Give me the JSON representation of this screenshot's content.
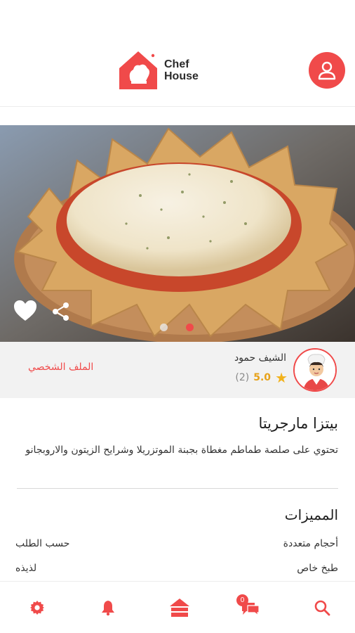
{
  "header": {
    "logo_line1": "Chef",
    "logo_line2": "House",
    "brand_color": "#f04a4a"
  },
  "hero": {
    "image_alt": "pizza",
    "icons": [
      "heart-icon",
      "share-icon"
    ],
    "slides": 2,
    "active_slide": 2
  },
  "chef": {
    "name": "الشيف حمود",
    "rating": "5.0",
    "rating_count": "(2)",
    "profile_link": "الملف الشخصي"
  },
  "recipe": {
    "title": "بيتزا مارجريتا",
    "description": "تحتوي على صلصة طماطم مغطاة بجبنة الموتزريلا وشرايح الزيتون والاروبجانو"
  },
  "features": {
    "title": "المميزات",
    "items": [
      {
        "label": "أحجام متعددة",
        "value": "حسب الطلب"
      },
      {
        "label": "طبخ خاص",
        "value": "لذيذه"
      }
    ]
  },
  "nav": {
    "items": [
      "settings-icon",
      "bell-icon",
      "home-icon",
      "messages-icon",
      "search-icon"
    ],
    "messages_badge": "0"
  }
}
